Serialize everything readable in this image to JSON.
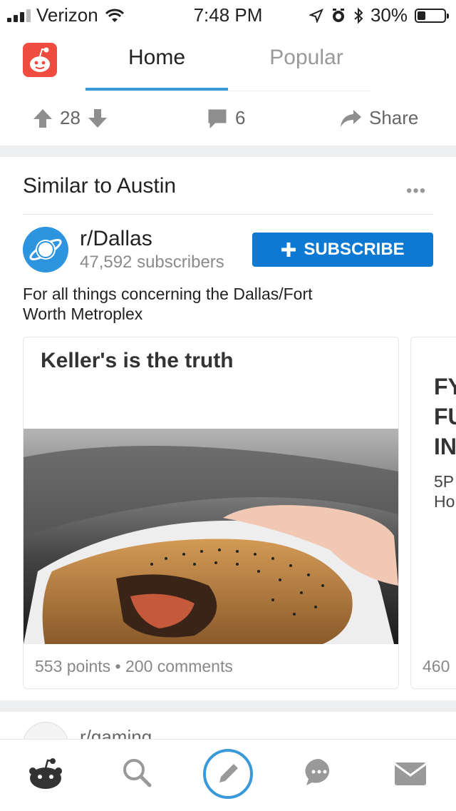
{
  "status_bar": {
    "carrier": "Verizon",
    "time": "7:48 PM",
    "battery": "30%",
    "battery_level": 0.3,
    "icons": [
      "signal-icon",
      "wifi-icon",
      "location-arrow-icon",
      "alarm-icon",
      "bluetooth-icon",
      "battery-icon"
    ]
  },
  "header": {
    "tabs": [
      {
        "label": "Home",
        "active": true
      },
      {
        "label": "Popular",
        "active": false
      }
    ],
    "accent": "#3a9ad9",
    "logo_color": "#ef4b3f"
  },
  "vote_bar": {
    "score": "28",
    "comments": "6",
    "share_label": "Share"
  },
  "similar_card": {
    "title": "Similar to Austin",
    "subreddit": {
      "name": "r/Dallas",
      "subscribers": "47,592 subscribers",
      "description": "For all things concerning the Dallas/Fort Worth Metroplex",
      "subscribe_label": "SUBSCRIBE",
      "button_color": "#0d79d3"
    },
    "posts": [
      {
        "title": "Keller's is the truth",
        "points": "553 points",
        "comments": "200 comments",
        "image": "burger-photo"
      },
      {
        "title_lines": [
          "FY",
          "FU",
          "IN"
        ],
        "subtitle_lines": [
          "5P",
          "Ho"
        ],
        "points": "460"
      }
    ]
  },
  "next_card": {
    "subreddit": "r/gaming"
  },
  "tab_bar": {
    "items": [
      "home-icon",
      "search-icon",
      "create-post-icon",
      "chat-icon",
      "inbox-icon"
    ],
    "create_color": "#3a9ad9"
  }
}
